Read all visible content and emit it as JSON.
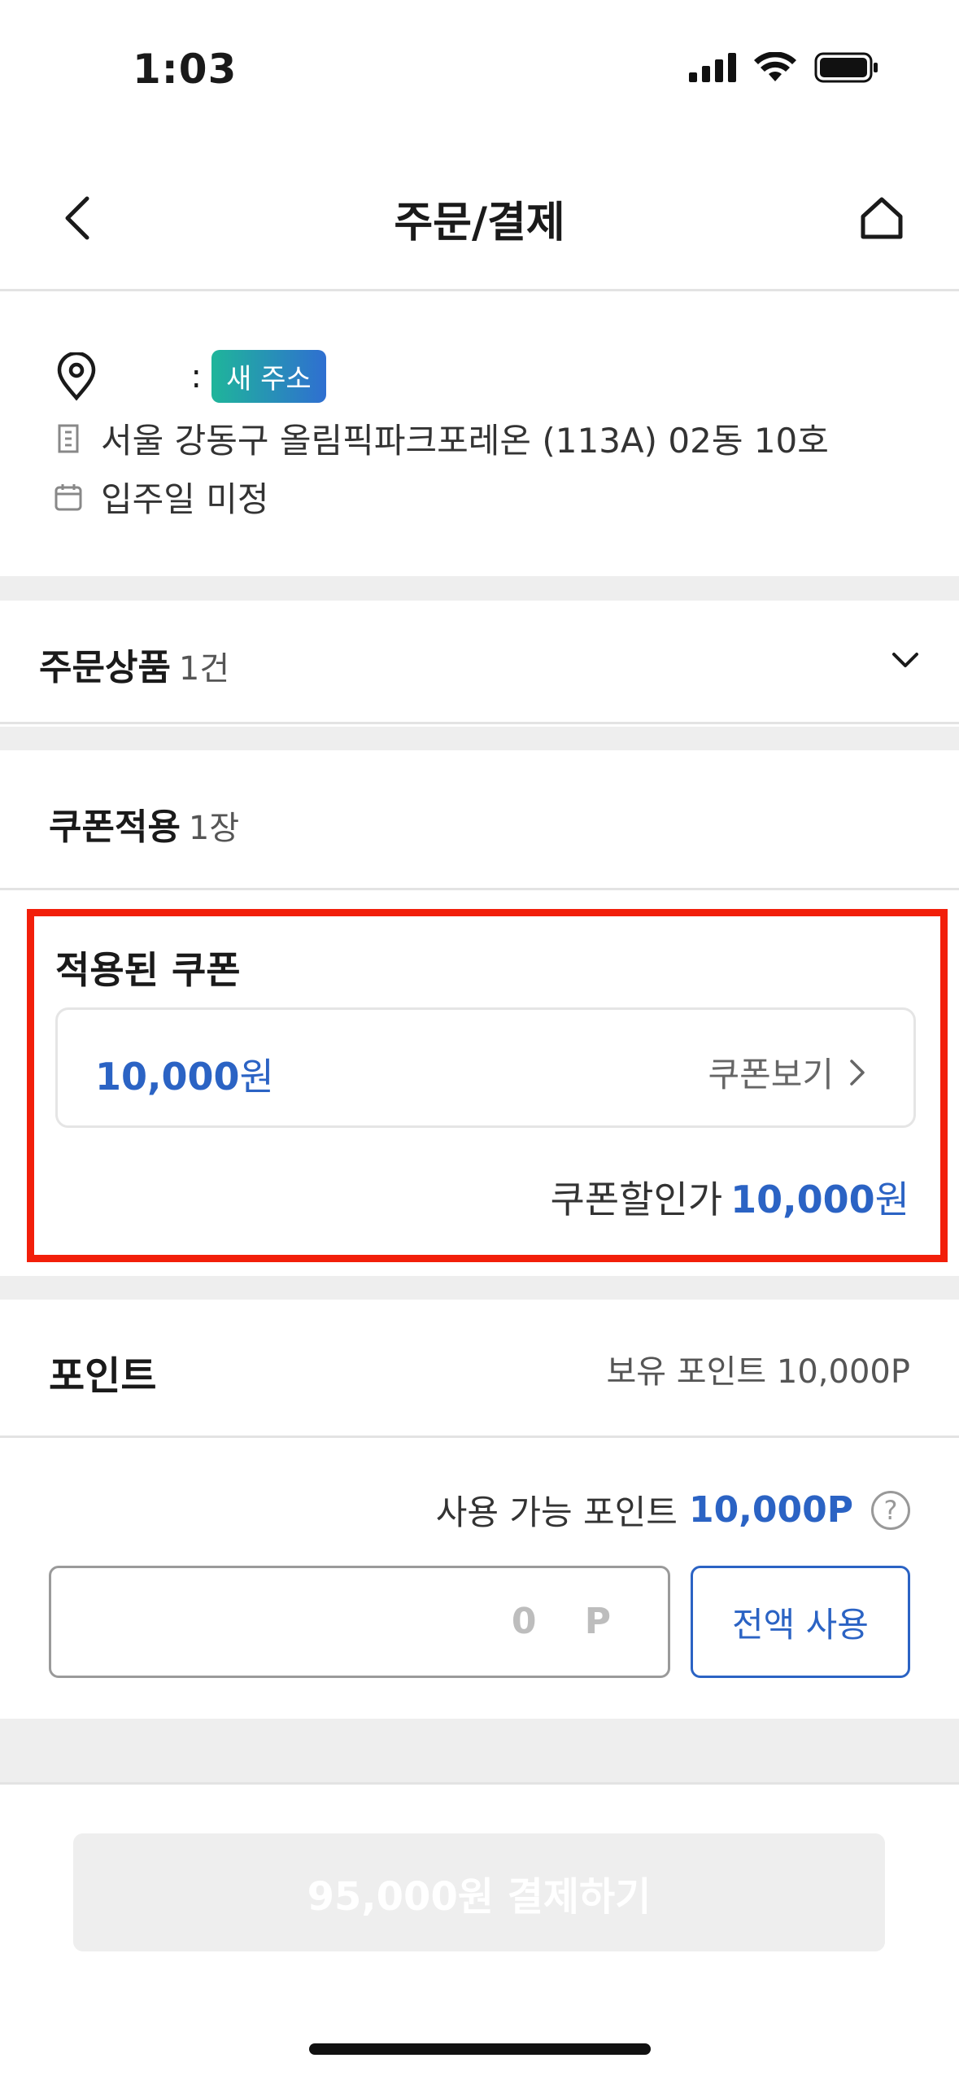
{
  "status_bar": {
    "time": "1:03"
  },
  "nav": {
    "title": "주문/결제"
  },
  "address": {
    "name": ":",
    "badge": "새 주소",
    "line": "서울 강동구 올림픽파크포레온 (113A) 02동 10호",
    "move_in": "입주일 미정"
  },
  "order_products": {
    "title": "주문상품",
    "count": "1건"
  },
  "coupon": {
    "title": "쿠폰적용",
    "count": "1장",
    "applied_title": "적용된 쿠폰",
    "amount": "10,000",
    "amount_unit": "원",
    "view_label": "쿠폰보기",
    "discount_label": "쿠폰할인가",
    "discount_value": "10,000",
    "discount_unit": "원"
  },
  "points": {
    "title": "포인트",
    "owned_label": "보유 포인트 10,000P",
    "available_label": "사용 가능 포인트",
    "available_value": "10,000P",
    "help": "?",
    "input_value": "0 P",
    "use_all_label": "전액 사용"
  },
  "pay": {
    "button_label": "95,000원 결제하기"
  },
  "colors": {
    "accent": "#2b63c4",
    "highlight_border": "#f21f0a"
  }
}
